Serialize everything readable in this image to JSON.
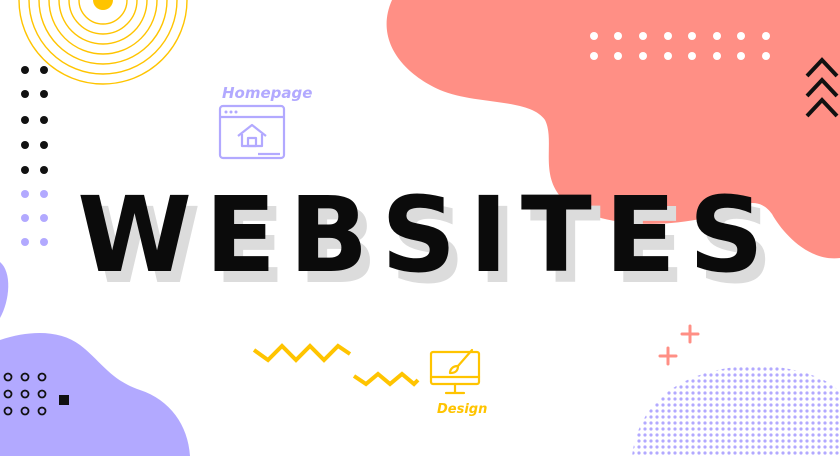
{
  "headline": "WEBSITES",
  "icons": {
    "homepage_label": "Homepage",
    "design_label": "Design"
  },
  "colors": {
    "coral_blob": "#ff8f85",
    "lavender": "#b2a9ff",
    "yellow": "#ffc400",
    "headline": "#0b0b0b",
    "shadow": "#dcdcdc"
  }
}
